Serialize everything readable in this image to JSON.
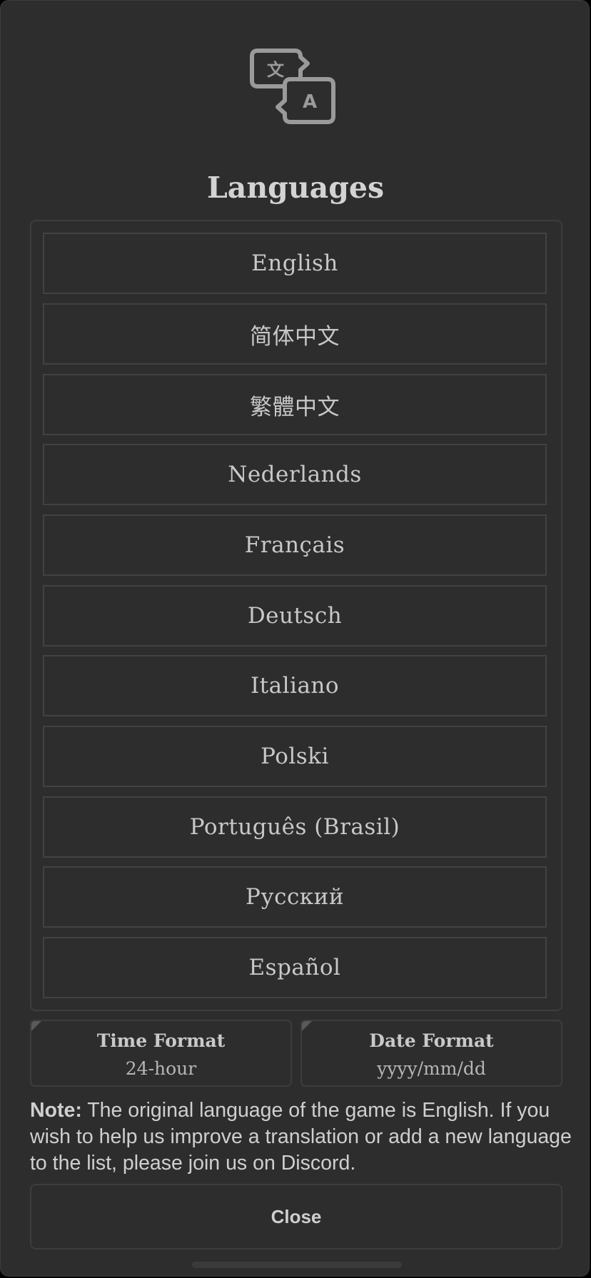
{
  "dialog": {
    "icon": "translate-icon",
    "icon_glyph_left": "文",
    "icon_glyph_right": "A",
    "title": "Languages"
  },
  "languages": [
    {
      "label": "English"
    },
    {
      "label": "简体中文"
    },
    {
      "label": "繁體中文"
    },
    {
      "label": "Nederlands"
    },
    {
      "label": "Français"
    },
    {
      "label": "Deutsch"
    },
    {
      "label": "Italiano"
    },
    {
      "label": "Polski"
    },
    {
      "label": "Português (Brasil)"
    },
    {
      "label": "Русский"
    },
    {
      "label": "Español"
    }
  ],
  "time_format": {
    "label": "Time Format",
    "value": "24-hour"
  },
  "date_format": {
    "label": "Date Format",
    "value": "yyyy/mm/dd"
  },
  "note": {
    "prefix": "Note:",
    "text": " The original language of the game is English. If you wish to help us improve a translation or add a new language to the list, please join us on Discord."
  },
  "close_button": {
    "label": "Close"
  },
  "colors": {
    "panel_background": "#2d2d2d",
    "border": "#3d3d3d",
    "text": "#c8c8c8",
    "icon_stroke": "#9a9a9a"
  }
}
